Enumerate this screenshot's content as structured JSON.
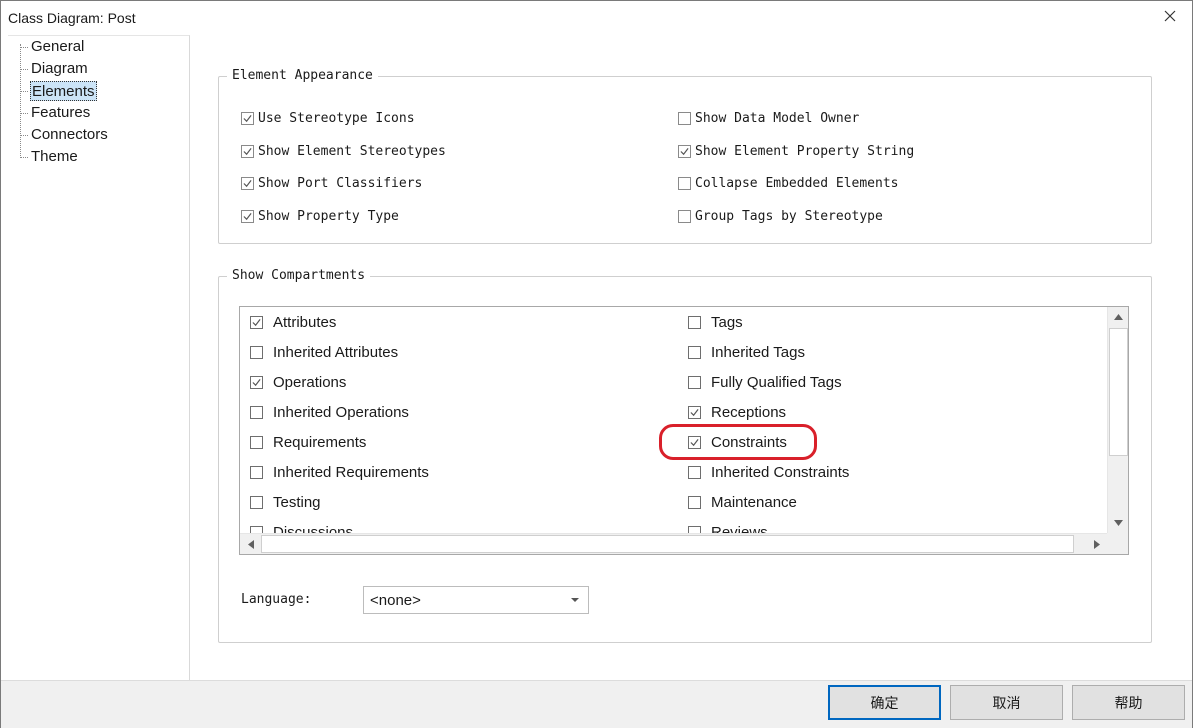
{
  "window": {
    "title": "Class Diagram: Post"
  },
  "tree": {
    "items": [
      {
        "label": "General",
        "selected": false
      },
      {
        "label": "Diagram",
        "selected": false
      },
      {
        "label": "Elements",
        "selected": true
      },
      {
        "label": "Features",
        "selected": false
      },
      {
        "label": "Connectors",
        "selected": false
      },
      {
        "label": "Theme",
        "selected": false
      }
    ]
  },
  "element_appearance": {
    "title": "Element Appearance",
    "left": [
      {
        "label": "Use Stereotype Icons",
        "checked": true
      },
      {
        "label": "Show Element Stereotypes",
        "checked": true
      },
      {
        "label": "Show Port Classifiers",
        "checked": true
      },
      {
        "label": "Show Property Type",
        "checked": true
      }
    ],
    "right": [
      {
        "label": "Show Data Model Owner",
        "checked": false
      },
      {
        "label": "Show Element Property String",
        "checked": true
      },
      {
        "label": "Collapse Embedded Elements",
        "checked": false
      },
      {
        "label": "Group Tags by Stereotype",
        "checked": false
      }
    ]
  },
  "compartments": {
    "title": "Show Compartments",
    "left": [
      {
        "label": "Attributes",
        "checked": true
      },
      {
        "label": "Inherited Attributes",
        "checked": false
      },
      {
        "label": "Operations",
        "checked": true
      },
      {
        "label": "Inherited Operations",
        "checked": false
      },
      {
        "label": "Requirements",
        "checked": false
      },
      {
        "label": "Inherited Requirements",
        "checked": false
      },
      {
        "label": "Testing",
        "checked": false
      },
      {
        "label": "Discussions",
        "checked": false
      }
    ],
    "right": [
      {
        "label": "Tags",
        "checked": false
      },
      {
        "label": "Inherited Tags",
        "checked": false
      },
      {
        "label": "Fully Qualified Tags",
        "checked": false
      },
      {
        "label": "Receptions",
        "checked": true
      },
      {
        "label": "Constraints",
        "checked": true
      },
      {
        "label": "Inherited Constraints",
        "checked": false
      },
      {
        "label": "Maintenance",
        "checked": false
      },
      {
        "label": "Reviews",
        "checked": false
      }
    ]
  },
  "language": {
    "label": "Language:",
    "value": "<none>"
  },
  "buttons": {
    "ok": "确定",
    "cancel": "取消",
    "help": "帮助"
  },
  "colors": {
    "highlight": "#d9202a",
    "default_button_border": "#0067c0"
  }
}
